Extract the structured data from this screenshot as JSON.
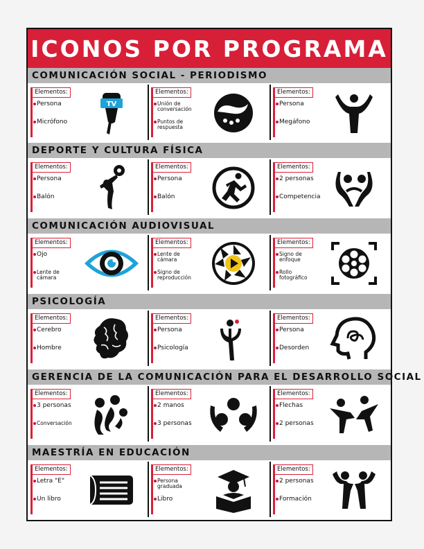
{
  "title": "ICONOS POR PROGRAMA",
  "label": "Elementos:",
  "colors": {
    "accent": "#d81f38",
    "section_bar": "#b6b6b6",
    "ink": "#111111",
    "yellow": "#f2c318",
    "blue": "#1ea3d8"
  },
  "sections": [
    {
      "name": "COMUNICACIÓN SOCIAL - PERIODISMO",
      "cells": [
        {
          "items": [
            "Persona",
            "Micrófono"
          ],
          "icon": "tv-microphone-icon",
          "badge": "TV"
        },
        {
          "items": [
            "Unión de conversación",
            "Puntos de respuesta"
          ],
          "icon": "yin-yang-dialogue-icon"
        },
        {
          "items": [
            "Persona",
            "Megáfono"
          ],
          "icon": "person-megaphone-icon"
        }
      ]
    },
    {
      "name": "DEPORTE Y CULTURA FÍSICA",
      "cells": [
        {
          "items": [
            "Persona",
            "Balón"
          ],
          "icon": "person-ball-icon"
        },
        {
          "items": [
            "Persona",
            "Balón"
          ],
          "icon": "runner-circle-icon"
        },
        {
          "items": [
            "2 personas",
            "Competencia"
          ],
          "icon": "two-persons-competition-icon"
        }
      ]
    },
    {
      "name": "COMUNICACIÓN AUDIOVISUAL",
      "cells": [
        {
          "items": [
            "Ojo",
            "Lente de cámara"
          ],
          "icon": "eye-lens-icon"
        },
        {
          "items": [
            "Lente de cámara",
            "Signo de reproducción"
          ],
          "icon": "shutter-play-icon"
        },
        {
          "items": [
            "Signo de enfoque",
            "Rollo fotográfico"
          ],
          "icon": "focus-film-reel-icon"
        }
      ]
    },
    {
      "name": "PSICOLOGÍA",
      "cells": [
        {
          "items": [
            "Cerebro",
            "Hombre"
          ],
          "icon": "brain-profile-icon"
        },
        {
          "items": [
            "Persona",
            "Psicología"
          ],
          "icon": "person-psi-icon"
        },
        {
          "items": [
            "Persona",
            "Desorden"
          ],
          "icon": "head-scribble-icon"
        }
      ]
    },
    {
      "name": "GERENCIA DE LA COMUNICACIÓN PARA EL DESARROLLO SOCIAL",
      "cells": [
        {
          "items": [
            "3 personas",
            "Conversación"
          ],
          "icon": "three-persons-conversation-icon"
        },
        {
          "items": [
            "2 manos",
            "3 personas"
          ],
          "icon": "hands-persons-icon"
        },
        {
          "items": [
            "Flechas",
            "2 personas"
          ],
          "icon": "arrows-persons-icon"
        }
      ]
    },
    {
      "name": "MAESTRÍA EN EDUCACIÓN",
      "cells": [
        {
          "items": [
            "Letra \"E\"",
            "Un libro"
          ],
          "icon": "letter-e-book-icon"
        },
        {
          "items": [
            "Persona graduada",
            "Libro"
          ],
          "icon": "graduate-book-icon"
        },
        {
          "items": [
            "2 personas",
            "Formación"
          ],
          "icon": "two-persons-formation-icon"
        }
      ]
    }
  ]
}
